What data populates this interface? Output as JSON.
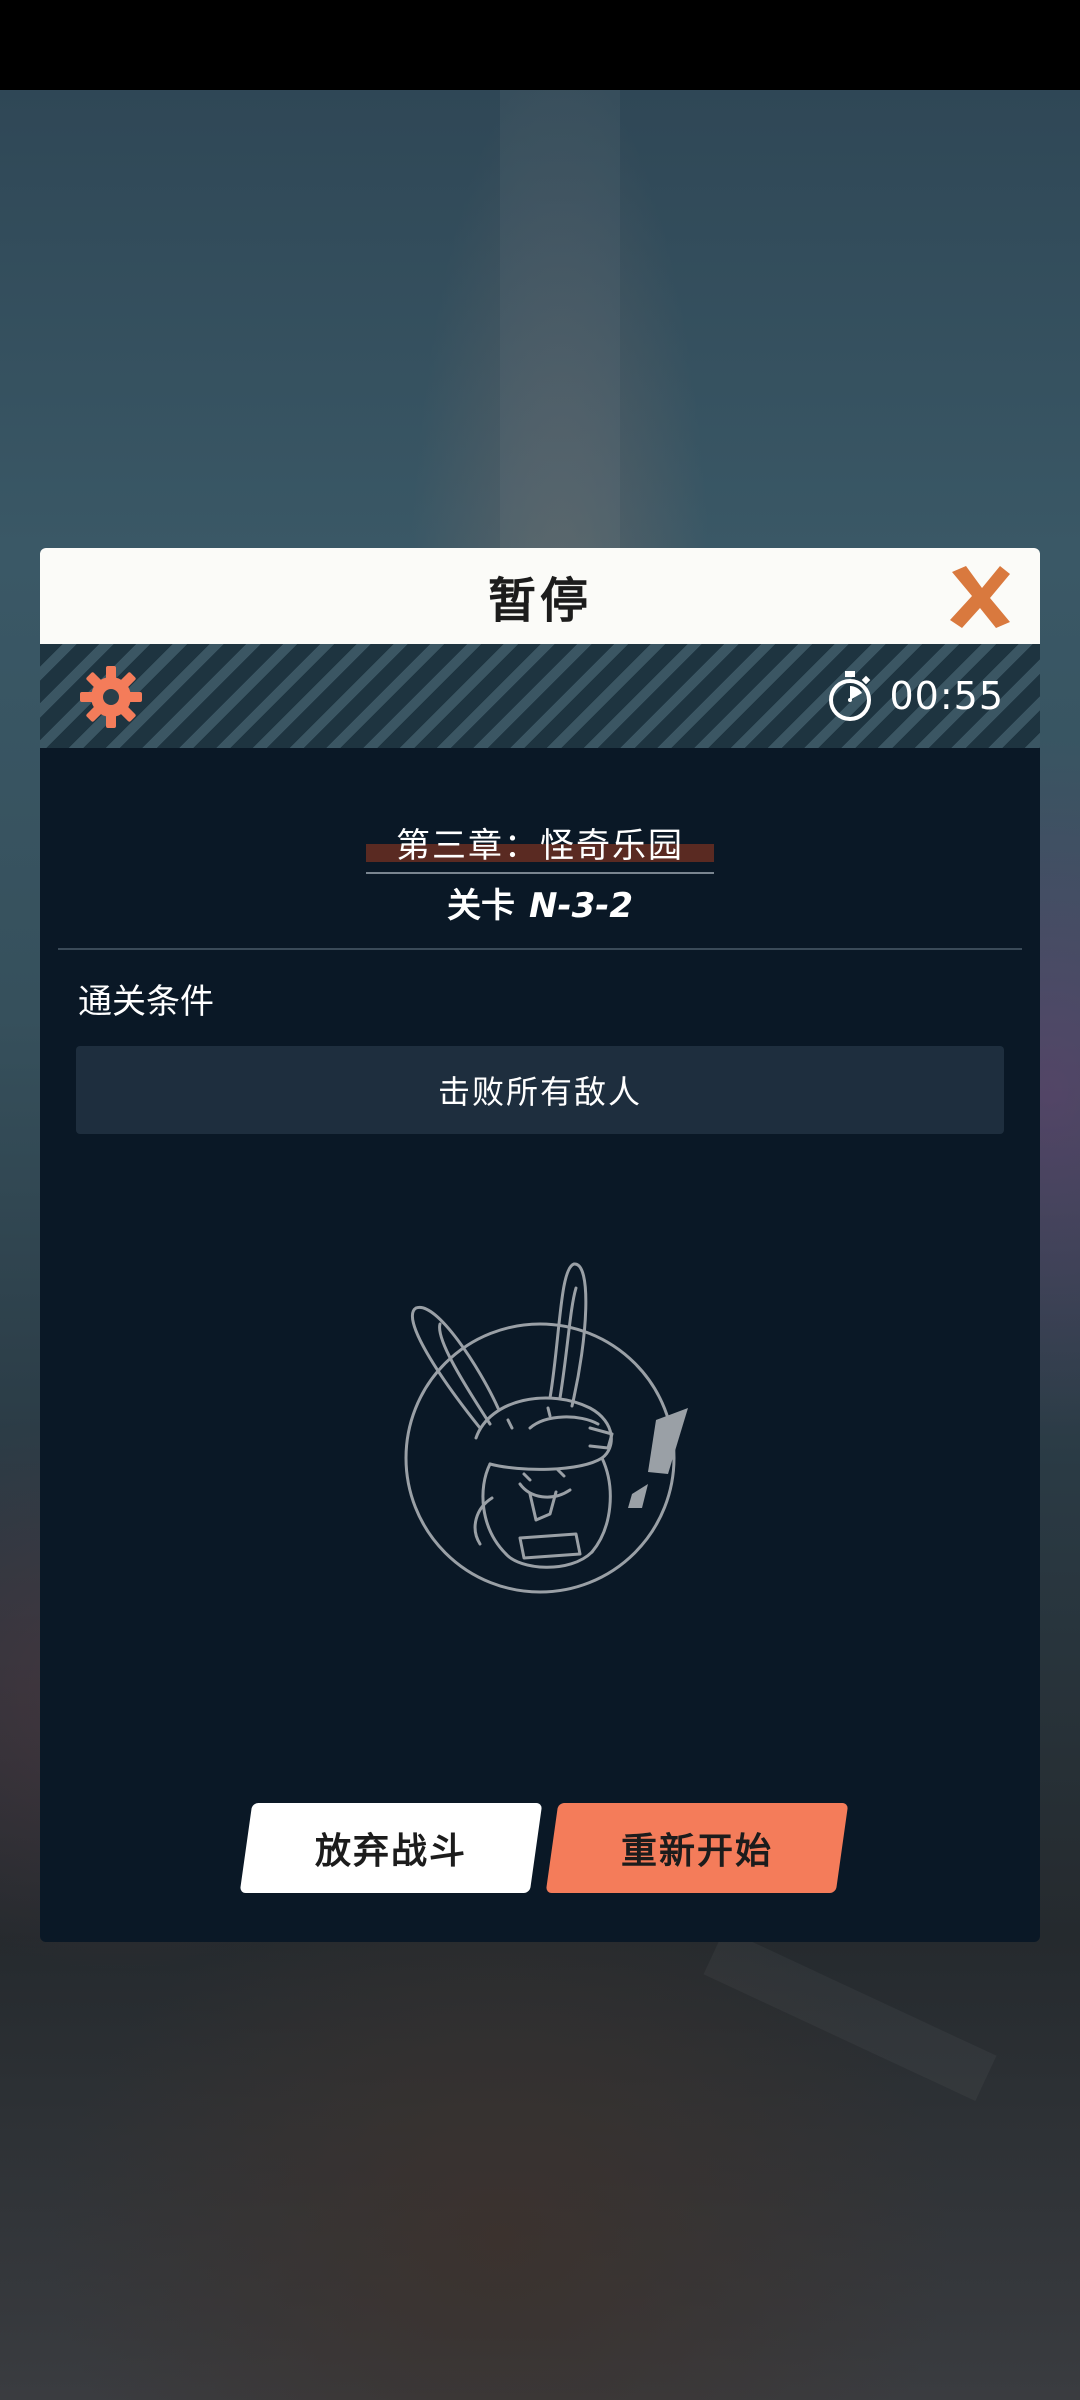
{
  "dialog": {
    "title": "暂停",
    "timer": "00:55",
    "chapter": "第三章：怪奇乐园",
    "stage_prefix": "关卡",
    "stage_code": "N-3-2",
    "condition_label": "通关条件",
    "condition": "击败所有敌人",
    "buttons": {
      "abandon": "放弃战斗",
      "restart": "重新开始"
    }
  },
  "icons": {
    "close": "close-x-icon",
    "settings": "gear-icon",
    "timer": "stopwatch-icon",
    "mascot": "bunny-mascot-icon"
  },
  "colors": {
    "accent": "#f47c5a",
    "close": "#d9793e",
    "panel": "#0a1826",
    "header": "#fbfbf8"
  }
}
